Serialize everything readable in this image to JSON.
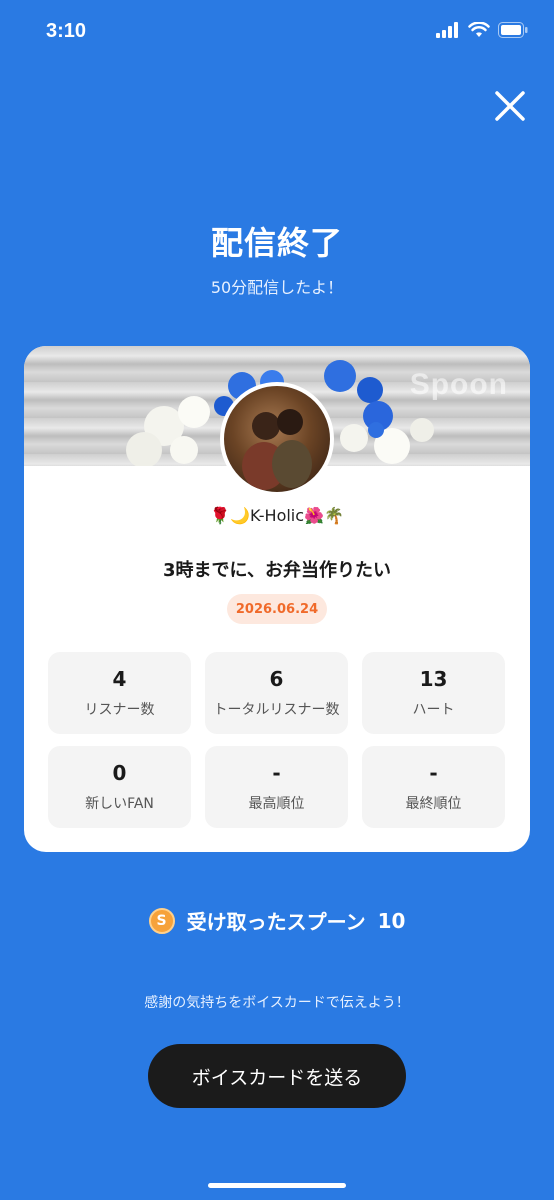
{
  "status_bar": {
    "time": "3:10"
  },
  "header": {
    "title": "配信終了",
    "subtitle": "50分配信したよ！"
  },
  "card": {
    "banner_watermark": "Spoon",
    "username": "🌹🌙K-Holic🌺🌴",
    "live_title": "3時までに、お弁当作りたい",
    "date": "2026.06.24",
    "stats": [
      {
        "value": "4",
        "label": "リスナー数"
      },
      {
        "value": "6",
        "label": "トータルリスナー数"
      },
      {
        "value": "13",
        "label": "ハート"
      },
      {
        "value": "0",
        "label": "新しいFAN"
      },
      {
        "value": "-",
        "label": "最高順位"
      },
      {
        "value": "-",
        "label": "最終順位"
      }
    ]
  },
  "spoons": {
    "label": "受け取ったスプーン",
    "count": "10"
  },
  "thanks_text": "感謝の気持ちをボイスカードで伝えよう！",
  "voice_button": "ボイスカードを送る",
  "colors": {
    "background": "#2a7ae3",
    "badge_text": "#f06a2a",
    "button_bg": "#1b1b1b"
  }
}
